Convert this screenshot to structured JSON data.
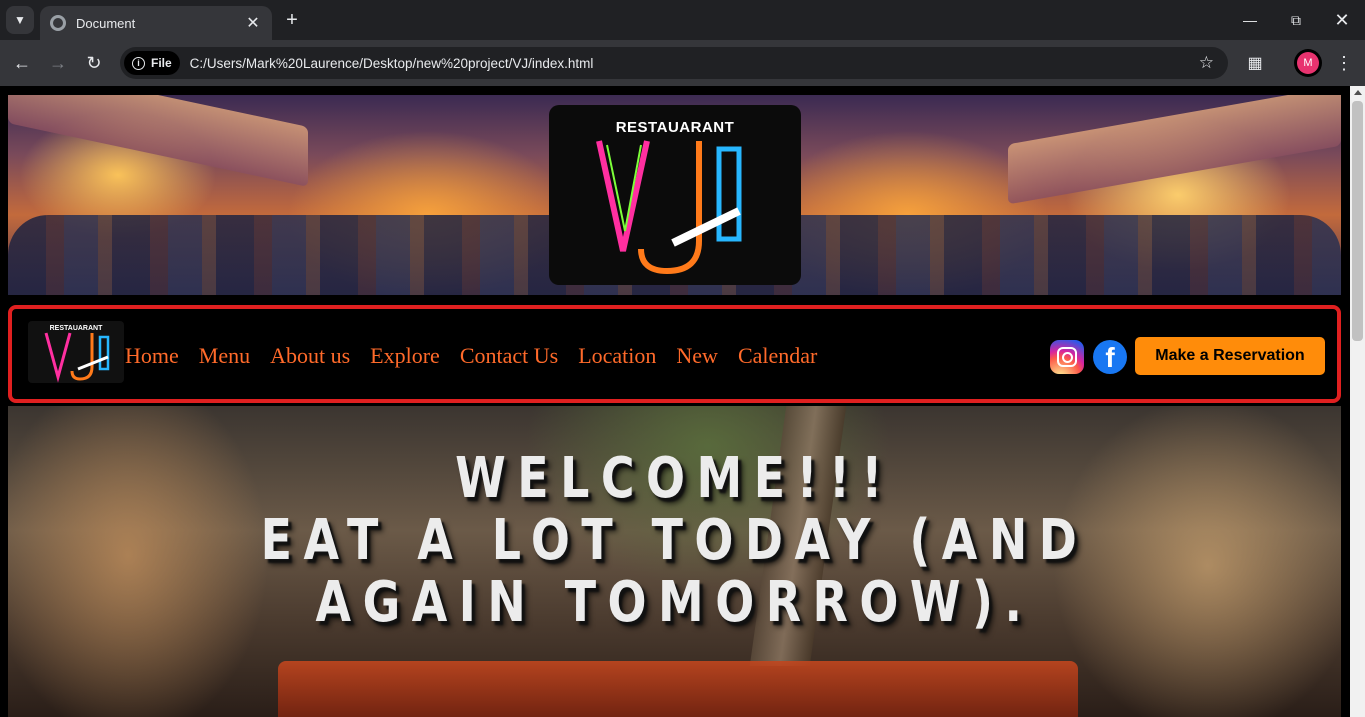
{
  "browser": {
    "tab_title": "Document",
    "url_chip": "File",
    "url": "C:/Users/Mark%20Laurence/Desktop/new%20project/VJ/index.html",
    "profile_initial": "M"
  },
  "banner": {
    "logo_text": "RESTAUARANT"
  },
  "navbar": {
    "logo_text": "RESTAUARANT",
    "links": [
      "Home",
      "Menu",
      "About us",
      "Explore",
      "Contact Us",
      "Location",
      "New",
      "Calendar"
    ],
    "reserve_label": "Make a Reservation",
    "accent_color": "#ff6a2a",
    "button_color": "#ff8c0a",
    "border_color": "#e02020"
  },
  "hero": {
    "line1": "WELCOME!!!",
    "line2": "EAT A LOT TODAY (AND AGAIN TOMORROW)."
  }
}
